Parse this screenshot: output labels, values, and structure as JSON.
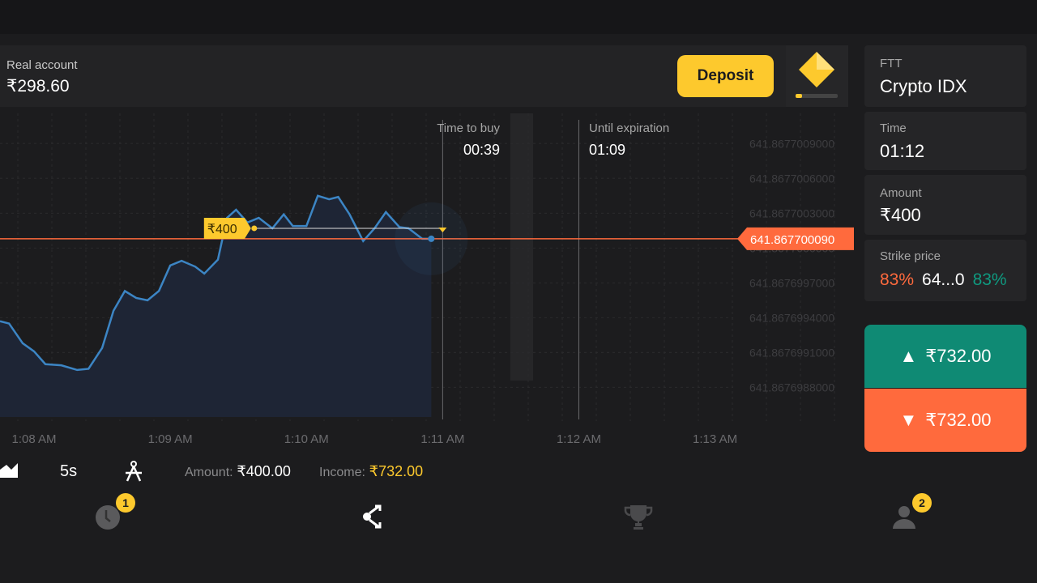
{
  "account": {
    "label": "Real account",
    "balance": "₹298.60",
    "deposit_label": "Deposit"
  },
  "side": {
    "asset_tag": "FTT",
    "asset_name": "Crypto IDX",
    "time_label": "Time",
    "time_value": "01:12",
    "amount_label": "Amount",
    "amount_value": "₹400",
    "strike_label": "Strike price",
    "strike_left_pct": "83%",
    "strike_value": "64...0",
    "strike_right_pct": "83%",
    "up_label": "₹732.00",
    "down_label": "₹732.00"
  },
  "timers": {
    "buy_label": "Time to buy",
    "buy_value": "00:39",
    "exp_label": "Until expiration",
    "exp_value": "01:09"
  },
  "toolbar": {
    "interval": "5s",
    "amount_label": "Amount:",
    "amount_value": "₹400.00",
    "income_label": "Income:",
    "income_value": "₹732.00"
  },
  "nav": {
    "history_badge": "1",
    "profile_badge": "2"
  },
  "colors": {
    "accent": "#fdc92d",
    "up": "#0f8a74",
    "down": "#ff6a3d",
    "line": "#3c85c4"
  },
  "chart_data": {
    "type": "area",
    "x": [
      "1:07:45",
      "1:07:49",
      "1:07:55",
      "1:08:00",
      "1:08:05",
      "1:08:12",
      "1:08:19",
      "1:08:24",
      "1:08:30",
      "1:08:35",
      "1:08:40",
      "1:08:45",
      "1:08:50",
      "1:08:55",
      "1:09:00",
      "1:09:05",
      "1:09:11",
      "1:09:15",
      "1:09:21",
      "1:09:25",
      "1:09:29",
      "1:09:34",
      "1:09:39",
      "1:09:45",
      "1:09:50",
      "1:09:54",
      "1:10:00",
      "1:10:05",
      "1:10:10",
      "1:10:14",
      "1:10:19",
      "1:10:25",
      "1:10:30",
      "1:10:35",
      "1:10:41",
      "1:10:45",
      "1:10:51",
      "1:10:55"
    ],
    "y": [
      641.86769937,
      641.86769935,
      641.86769918,
      641.86769911,
      641.867699,
      641.86769899,
      641.86769895,
      641.86769896,
      641.86769914,
      641.86769946,
      641.86769963,
      641.86769957,
      641.86769955,
      641.86769963,
      641.86769985,
      641.86769989,
      641.86769984,
      641.86769978,
      641.8676999,
      641.86770026,
      641.86770033,
      641.86770022,
      641.86770026,
      641.86770017,
      641.86770029,
      641.86770019,
      641.86770019,
      641.86770045,
      641.86770042,
      641.86770044,
      641.86770029,
      641.86770006,
      641.86770017,
      641.86770031,
      641.86770018,
      641.86770017,
      641.86770008,
      641.86770008
    ],
    "xlim": [
      "1:07:45",
      "1:13:08"
    ],
    "ylim": [
      641.86769851,
      641.86770116
    ],
    "x_ticks": [
      "1:08 AM",
      "1:09 AM",
      "1:10 AM",
      "1:11 AM",
      "1:12 AM",
      "1:13 AM"
    ],
    "x_tick_times": [
      "1:08:00",
      "1:09:00",
      "1:10:00",
      "1:11:00",
      "1:12:00",
      "1:13:00"
    ],
    "y_ticks": [
      "641.8677009000",
      "641.8677006000",
      "641.8677003000",
      "641.8677000000",
      "641.8676997000",
      "641.8676994000",
      "641.8676991000",
      "641.8676988000"
    ],
    "current_price": "641.867700090",
    "entry": {
      "label": "₹400",
      "time": "1:09:37",
      "price": 641.86770017
    },
    "buy_deadline": "1:11:00",
    "expiration": "1:12:00",
    "grid": true
  }
}
